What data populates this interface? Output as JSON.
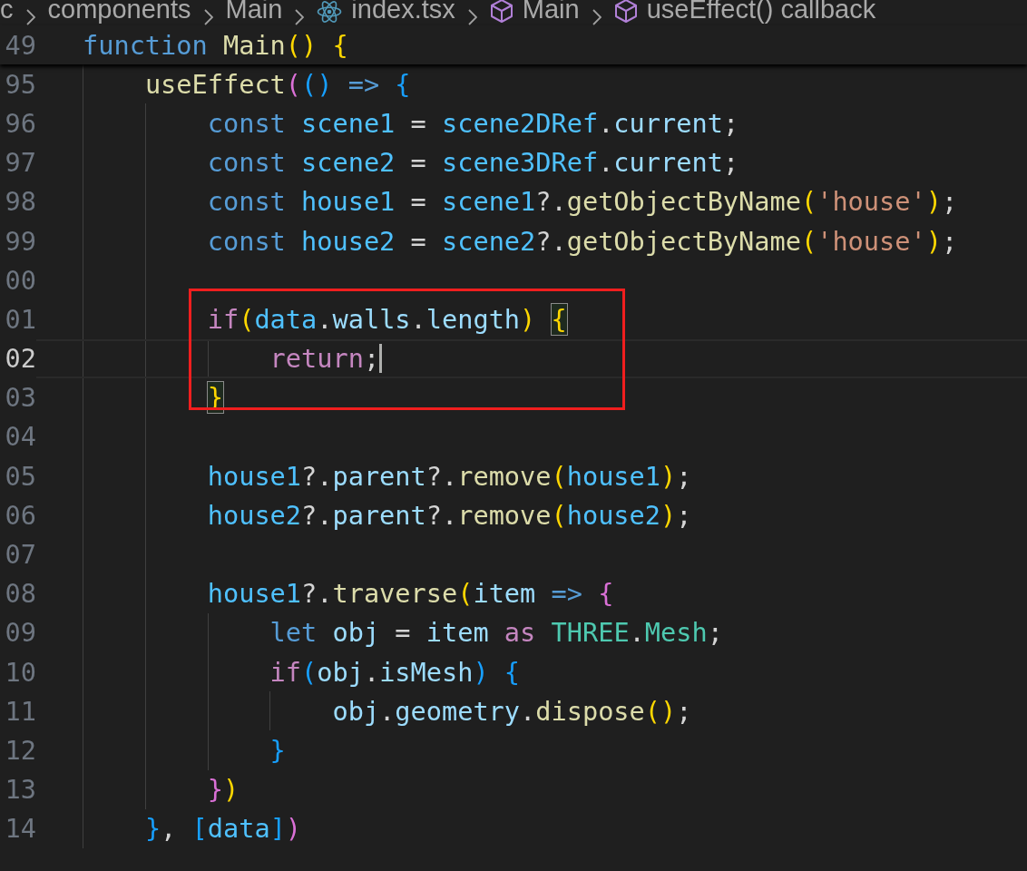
{
  "breadcrumb": [
    {
      "text": "c",
      "kind": "folder"
    },
    {
      "text": "components",
      "kind": "folder"
    },
    {
      "text": "Main",
      "kind": "folder"
    },
    {
      "text": "index.tsx",
      "kind": "react-file"
    },
    {
      "text": "Main",
      "kind": "symbol"
    },
    {
      "text": "useEffect() callback",
      "kind": "symbol"
    }
  ],
  "sticky_line": {
    "number": "49",
    "tokens": [
      {
        "text": "function ",
        "color": "#569cd6"
      },
      {
        "text": "Main",
        "color": "#dcdcaa"
      },
      {
        "text": "() ",
        "color": "#ffd700"
      },
      {
        "text": "{",
        "color": "#ffd700"
      }
    ]
  },
  "lines": [
    {
      "number": "95",
      "current": false,
      "boxed": false,
      "tokens": [
        {
          "text": "    useEffect",
          "color": "#dcdcaa"
        },
        {
          "text": "(",
          "color": "#da70d6"
        },
        {
          "text": "() ",
          "color": "#179fff"
        },
        {
          "text": "=> ",
          "color": "#569cd6"
        },
        {
          "text": "{",
          "color": "#179fff"
        }
      ]
    },
    {
      "number": "96",
      "current": false,
      "boxed": false,
      "tokens": [
        {
          "text": "        const ",
          "color": "#569cd6"
        },
        {
          "text": "scene1",
          "color": "#4fc1ff"
        },
        {
          "text": " = ",
          "color": "#d4d4d4"
        },
        {
          "text": "scene2DRef",
          "color": "#4fc1ff"
        },
        {
          "text": ".",
          "color": "#d4d4d4"
        },
        {
          "text": "current",
          "color": "#9cdcfe"
        },
        {
          "text": ";",
          "color": "#d4d4d4"
        }
      ]
    },
    {
      "number": "97",
      "current": false,
      "boxed": false,
      "tokens": [
        {
          "text": "        const ",
          "color": "#569cd6"
        },
        {
          "text": "scene2",
          "color": "#4fc1ff"
        },
        {
          "text": " = ",
          "color": "#d4d4d4"
        },
        {
          "text": "scene3DRef",
          "color": "#4fc1ff"
        },
        {
          "text": ".",
          "color": "#d4d4d4"
        },
        {
          "text": "current",
          "color": "#9cdcfe"
        },
        {
          "text": ";",
          "color": "#d4d4d4"
        }
      ]
    },
    {
      "number": "98",
      "current": false,
      "boxed": false,
      "tokens": [
        {
          "text": "        const ",
          "color": "#569cd6"
        },
        {
          "text": "house1",
          "color": "#4fc1ff"
        },
        {
          "text": " = ",
          "color": "#d4d4d4"
        },
        {
          "text": "scene1",
          "color": "#4fc1ff"
        },
        {
          "text": "?.",
          "color": "#d4d4d4"
        },
        {
          "text": "getObjectByName",
          "color": "#dcdcaa"
        },
        {
          "text": "(",
          "color": "#ffd700"
        },
        {
          "text": "'house'",
          "color": "#ce9178"
        },
        {
          "text": ")",
          "color": "#ffd700"
        },
        {
          "text": ";",
          "color": "#d4d4d4"
        }
      ]
    },
    {
      "number": "99",
      "current": false,
      "boxed": false,
      "tokens": [
        {
          "text": "        const ",
          "color": "#569cd6"
        },
        {
          "text": "house2",
          "color": "#4fc1ff"
        },
        {
          "text": " = ",
          "color": "#d4d4d4"
        },
        {
          "text": "scene2",
          "color": "#4fc1ff"
        },
        {
          "text": "?.",
          "color": "#d4d4d4"
        },
        {
          "text": "getObjectByName",
          "color": "#dcdcaa"
        },
        {
          "text": "(",
          "color": "#ffd700"
        },
        {
          "text": "'house'",
          "color": "#ce9178"
        },
        {
          "text": ")",
          "color": "#ffd700"
        },
        {
          "text": ";",
          "color": "#d4d4d4"
        }
      ]
    },
    {
      "number": "00",
      "current": false,
      "boxed": false
    },
    {
      "number": "01",
      "current": false,
      "boxed": true,
      "tokens": [
        {
          "text": "        if",
          "color": "#c586c0"
        },
        {
          "text": "(",
          "color": "#ffd700"
        },
        {
          "text": "data",
          "color": "#4fc1ff"
        },
        {
          "text": ".",
          "color": "#d4d4d4"
        },
        {
          "text": "walls",
          "color": "#9cdcfe"
        },
        {
          "text": ".",
          "color": "#d4d4d4"
        },
        {
          "text": "length",
          "color": "#9cdcfe"
        },
        {
          "text": ") ",
          "color": "#ffd700"
        },
        {
          "text": "{",
          "color": "#ffd700",
          "matched": true
        }
      ]
    },
    {
      "number": "02",
      "current": true,
      "boxed": true,
      "tokens": [
        {
          "text": "            return",
          "color": "#c586c0"
        },
        {
          "text": ";",
          "color": "#d4d4d4"
        }
      ]
    },
    {
      "number": "03",
      "current": false,
      "boxed": true,
      "tokens": [
        {
          "text": "        }",
          "color": "#ffd700",
          "matched": true
        }
      ]
    },
    {
      "number": "04",
      "current": false,
      "boxed": false
    },
    {
      "number": "05",
      "current": false,
      "boxed": false,
      "tokens": [
        {
          "text": "        house1",
          "color": "#4fc1ff"
        },
        {
          "text": "?.",
          "color": "#d4d4d4"
        },
        {
          "text": "parent",
          "color": "#9cdcfe"
        },
        {
          "text": "?.",
          "color": "#d4d4d4"
        },
        {
          "text": "remove",
          "color": "#dcdcaa"
        },
        {
          "text": "(",
          "color": "#ffd700"
        },
        {
          "text": "house1",
          "color": "#4fc1ff"
        },
        {
          "text": ")",
          "color": "#ffd700"
        },
        {
          "text": ";",
          "color": "#d4d4d4"
        }
      ]
    },
    {
      "number": "06",
      "current": false,
      "boxed": false,
      "tokens": [
        {
          "text": "        house2",
          "color": "#4fc1ff"
        },
        {
          "text": "?.",
          "color": "#d4d4d4"
        },
        {
          "text": "parent",
          "color": "#9cdcfe"
        },
        {
          "text": "?.",
          "color": "#d4d4d4"
        },
        {
          "text": "remove",
          "color": "#dcdcaa"
        },
        {
          "text": "(",
          "color": "#ffd700"
        },
        {
          "text": "house2",
          "color": "#4fc1ff"
        },
        {
          "text": ")",
          "color": "#ffd700"
        },
        {
          "text": ";",
          "color": "#d4d4d4"
        }
      ]
    },
    {
      "number": "07",
      "current": false,
      "boxed": false
    },
    {
      "number": "08",
      "current": false,
      "boxed": false,
      "tokens": [
        {
          "text": "        house1",
          "color": "#4fc1ff"
        },
        {
          "text": "?.",
          "color": "#d4d4d4"
        },
        {
          "text": "traverse",
          "color": "#dcdcaa"
        },
        {
          "text": "(",
          "color": "#ffd700"
        },
        {
          "text": "item ",
          "color": "#9cdcfe"
        },
        {
          "text": "=> ",
          "color": "#569cd6"
        },
        {
          "text": "{",
          "color": "#da70d6"
        }
      ]
    },
    {
      "number": "09",
      "current": false,
      "boxed": false,
      "tokens": [
        {
          "text": "            let ",
          "color": "#569cd6"
        },
        {
          "text": "obj",
          "color": "#9cdcfe"
        },
        {
          "text": " = ",
          "color": "#d4d4d4"
        },
        {
          "text": "item ",
          "color": "#9cdcfe"
        },
        {
          "text": "as ",
          "color": "#c586c0"
        },
        {
          "text": "THREE",
          "color": "#4ec9b0"
        },
        {
          "text": ".",
          "color": "#d4d4d4"
        },
        {
          "text": "Mesh",
          "color": "#4ec9b0"
        },
        {
          "text": ";",
          "color": "#d4d4d4"
        }
      ]
    },
    {
      "number": "10",
      "current": false,
      "boxed": false,
      "tokens": [
        {
          "text": "            if",
          "color": "#c586c0"
        },
        {
          "text": "(",
          "color": "#179fff"
        },
        {
          "text": "obj",
          "color": "#9cdcfe"
        },
        {
          "text": ".",
          "color": "#d4d4d4"
        },
        {
          "text": "isMesh",
          "color": "#9cdcfe"
        },
        {
          "text": ") ",
          "color": "#179fff"
        },
        {
          "text": "{",
          "color": "#179fff"
        }
      ]
    },
    {
      "number": "11",
      "current": false,
      "boxed": false,
      "tokens": [
        {
          "text": "                obj",
          "color": "#9cdcfe"
        },
        {
          "text": ".",
          "color": "#d4d4d4"
        },
        {
          "text": "geometry",
          "color": "#9cdcfe"
        },
        {
          "text": ".",
          "color": "#d4d4d4"
        },
        {
          "text": "dispose",
          "color": "#dcdcaa"
        },
        {
          "text": "()",
          "color": "#ffd700"
        },
        {
          "text": ";",
          "color": "#d4d4d4"
        }
      ]
    },
    {
      "number": "12",
      "current": false,
      "boxed": false,
      "tokens": [
        {
          "text": "            }",
          "color": "#179fff"
        }
      ]
    },
    {
      "number": "13",
      "current": false,
      "boxed": false,
      "tokens": [
        {
          "text": "        }",
          "color": "#da70d6"
        },
        {
          "text": ")",
          "color": "#ffd700"
        }
      ]
    },
    {
      "number": "14",
      "current": false,
      "boxed": false,
      "tokens": [
        {
          "text": "    }",
          "color": "#179fff"
        },
        {
          "text": ", ",
          "color": "#d4d4d4"
        },
        {
          "text": "[",
          "color": "#179fff"
        },
        {
          "text": "data",
          "color": "#4fc1ff"
        },
        {
          "text": "]",
          "color": "#179fff"
        },
        {
          "text": ")",
          "color": "#da70d6"
        }
      ]
    }
  ]
}
